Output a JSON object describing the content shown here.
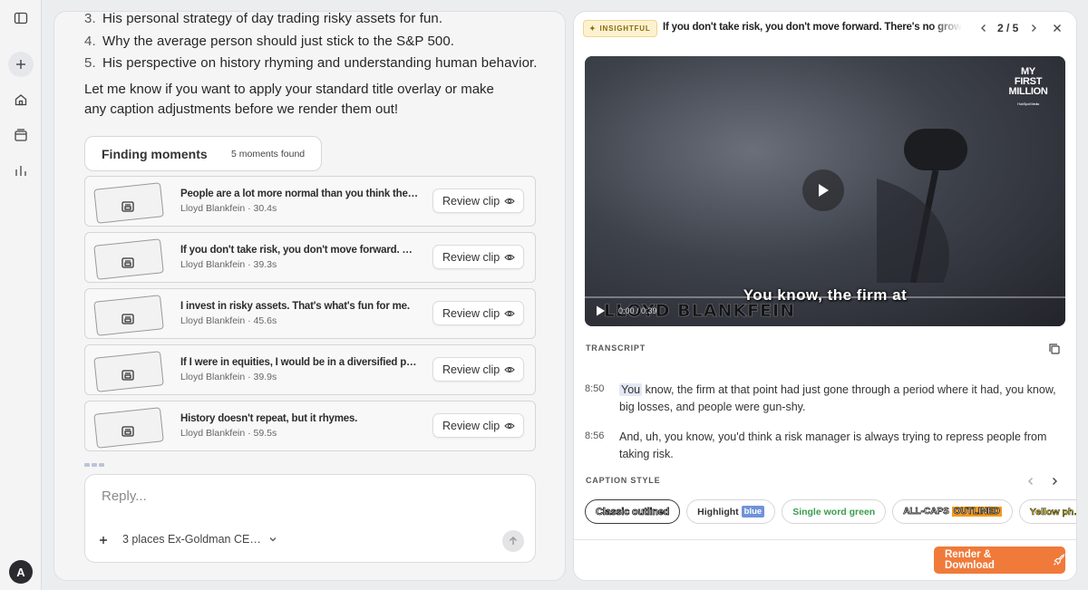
{
  "rail": {
    "avatar_initial": "A"
  },
  "chat": {
    "list": [
      {
        "num": "3.",
        "text": "His personal strategy of day trading risky assets for fun."
      },
      {
        "num": "4.",
        "text": "Why the average person should just stick to the S&P 500."
      },
      {
        "num": "5.",
        "text": "His perspective on history rhyming and understanding human behavior."
      }
    ],
    "closing_paragraph": "Let me know if you want to apply your standard title overlay or make any caption adjustments before we render them out!",
    "finding": {
      "title": "Finding moments",
      "count": "5 moments found"
    },
    "moments": [
      {
        "title": "People are a lot more normal than you think the…",
        "meta": "Lloyd Blankfein · 30.4s",
        "button": "Review clip"
      },
      {
        "title": "If you don't take risk, you don't move forward. …",
        "meta": "Lloyd Blankfein · 39.3s",
        "button": "Review clip"
      },
      {
        "title": "I invest in risky assets. That's what's fun for me.",
        "meta": "Lloyd Blankfein · 45.6s",
        "button": "Review clip"
      },
      {
        "title": "If I were in equities, I would be in a diversified p…",
        "meta": "Lloyd Blankfein · 39.9s",
        "button": "Review clip"
      },
      {
        "title": "History doesn't repeat, but it rhymes.",
        "meta": "Lloyd Blankfein · 59.5s",
        "button": "Review clip"
      }
    ],
    "reply": {
      "placeholder": "Reply...",
      "context_chip": "3 places Ex-Goldman CE…"
    }
  },
  "panel": {
    "badge": "INSIGHTFUL",
    "title": "If you don't take risk, you don't move forward. There's no growth…",
    "pager": "2 / 5",
    "video": {
      "logo_line1": "MY",
      "logo_line2": "FIRST",
      "logo_line3": "MILLION",
      "logo_sub": "HubSpot Media",
      "caption": "You know, the firm at",
      "lower_third": "LLOYD BLANKFEIN",
      "time": "0:00 / 0:39",
      "progress": 0.0
    },
    "transcript_label": "TRANSCRIPT",
    "transcript": [
      {
        "time": "8:50",
        "highlight": "You",
        "text": " know, the firm at that point had just gone through a period where it had, you know, big losses, and people were gun-shy."
      },
      {
        "time": "8:56",
        "highlight": "",
        "text": "And, uh, you know, you'd think a risk manager is always trying to repress people from taking risk."
      }
    ],
    "caption_style_label": "CAPTION STYLE",
    "caption_styles": [
      {
        "label": "Classic outlined",
        "selected": true
      },
      {
        "label": "Highlight",
        "tag": "blue"
      },
      {
        "label": "Single word green"
      },
      {
        "label_a": "ALL-CAPS",
        "label_b": "OUTLINED"
      },
      {
        "label": "Yellow ph…"
      }
    ],
    "render_button": "Render & Download"
  },
  "colors": {
    "accent_orange": "#f07a3a",
    "badge_bg": "#fdf2cf",
    "highlight_blue": "#6f93d8",
    "green": "#3a9d4e"
  }
}
